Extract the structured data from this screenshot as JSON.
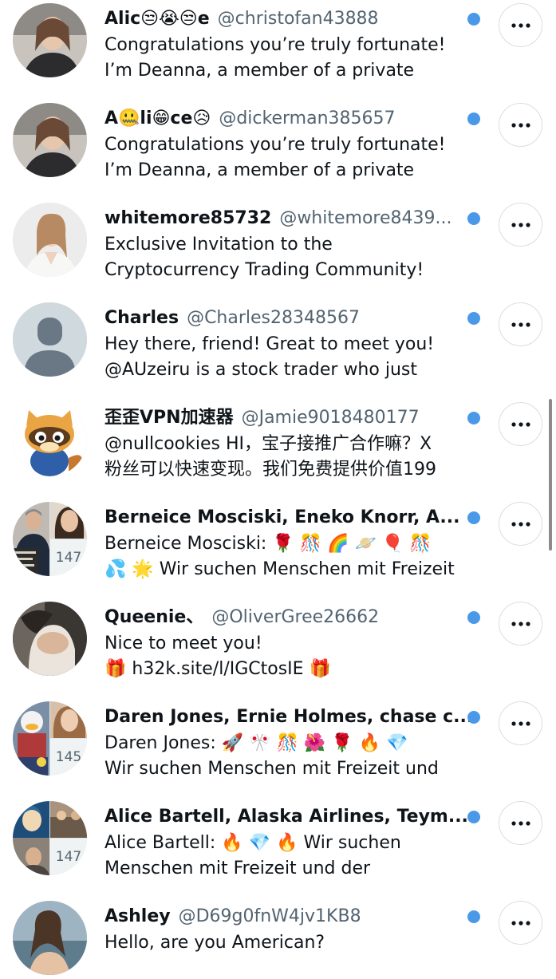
{
  "conversations": [
    {
      "name": "Alic😒😭😒e",
      "handle": "@christofan43888",
      "preview_line1": "Congratulations you’re truly fortunate!",
      "preview_line2": "I’m Deanna, a member of a private"
    },
    {
      "name": "A🤐li😁ce😥",
      "handle": "@dickerman385657",
      "preview_line1": "Congratulations you’re truly fortunate!",
      "preview_line2": "I’m Deanna, a member of a private"
    },
    {
      "name": "whitemore85732",
      "handle": "@whitemore8439...",
      "preview_line1": "Exclusive Invitation to the",
      "preview_line2": "Cryptocurrency Trading Community!"
    },
    {
      "name": "Charles",
      "handle": "@Charles28348567",
      "preview_line1": "Hey there, friend! Great to meet you!",
      "preview_line2": "@AUzeiru is a stock trader who just"
    },
    {
      "name": "歪歪VPN加速器",
      "handle": "@Jamie9018480177",
      "preview_line1": "@nullcookies HI，宝子接推广合作嘛？X",
      "preview_line2": "粉丝可以快速变现。我们免费提供价值199"
    },
    {
      "name": "Berneice Mosciski, Eneko Knorr, A...",
      "handle": "",
      "preview_line1": "Berneice Mosciski: 🌹 🎊 🌈 🪐 🎈 🎊",
      "preview_line2": "💦 🌟 Wir suchen Menschen mit Freizeit",
      "member_count": "147"
    },
    {
      "name": "Queenie、",
      "handle": "@OliverGree26662",
      "preview_line1": "Nice to meet you!",
      "preview_line2": "🎁 h32k.site/l/IGCtosIE 🎁"
    },
    {
      "name": "Daren Jones, Ernie Holmes, chase c...",
      "handle": "",
      "preview_line1": "Daren Jones: 🚀 🎌 🎊 🌺 🌹 🔥 💎",
      "preview_line2": "Wir suchen Menschen mit Freizeit und",
      "member_count": "145"
    },
    {
      "name": "Alice Bartell, Alaska Airlines, Teym...",
      "handle": "",
      "preview_line1": "Alice Bartell: 🔥 💎 🔥 Wir suchen",
      "preview_line2": "Menschen mit Freizeit und der",
      "member_count": "147"
    },
    {
      "name": "Ashley",
      "handle": "@D69g0fnW4jv1KB8",
      "preview_line1": "Hello, are you American?",
      "preview_line2": ""
    }
  ],
  "colors": {
    "unread_dot": "#4a99e9",
    "secondary_text": "#536471",
    "primary_text": "#0f1419",
    "button_border": "#d8dee2"
  },
  "icons": {
    "more": "more-horizontal-icon",
    "default_avatar": "default-avatar-icon"
  }
}
